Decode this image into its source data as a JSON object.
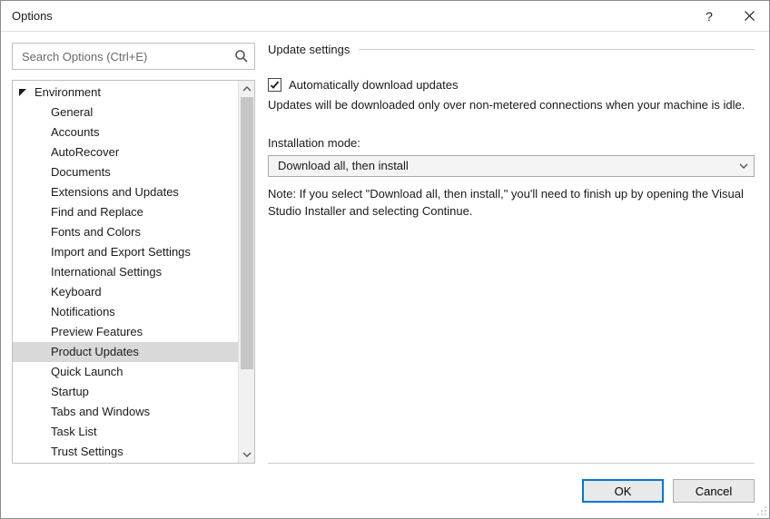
{
  "window": {
    "title": "Options"
  },
  "search": {
    "placeholder": "Search Options (Ctrl+E)"
  },
  "tree": {
    "root_label": "Environment",
    "items": [
      "General",
      "Accounts",
      "AutoRecover",
      "Documents",
      "Extensions and Updates",
      "Find and Replace",
      "Fonts and Colors",
      "Import and Export Settings",
      "International Settings",
      "Keyboard",
      "Notifications",
      "Preview Features",
      "Product Updates",
      "Quick Launch",
      "Startup",
      "Tabs and Windows",
      "Task List",
      "Trust Settings"
    ],
    "selected_index": 12
  },
  "panel": {
    "heading": "Update settings",
    "auto_download_checked": true,
    "auto_download_label": "Automatically download updates",
    "auto_download_desc": "Updates will be downloaded only over non-metered connections when your machine is idle.",
    "install_mode_label": "Installation mode:",
    "install_mode_value": "Download all, then install",
    "note": "Note: If you select \"Download all, then install,\" you'll need to finish up by opening the Visual Studio Installer and selecting Continue."
  },
  "buttons": {
    "ok": "OK",
    "cancel": "Cancel"
  }
}
